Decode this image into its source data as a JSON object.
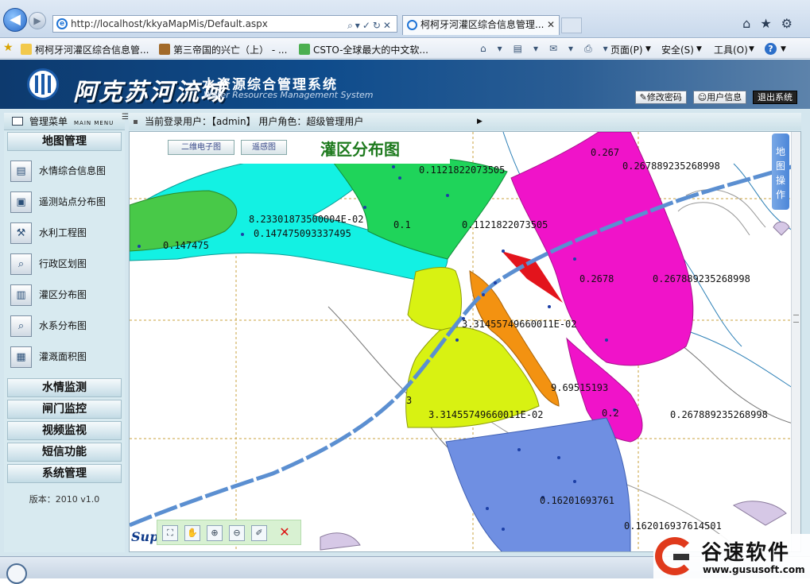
{
  "browser": {
    "url": "http://localhost/kkyaMapMis/Default.aspx",
    "tab_title": "柯柯牙河灌区综合信息管理...",
    "tab_close": "✕",
    "favorites": [
      {
        "label": "柯柯牙河灌区综合信息管...",
        "icon_color": "#f2c94c"
      },
      {
        "label": "第三帝国的兴亡（上） - ...",
        "icon_color": "#a26a2a"
      },
      {
        "label": "CSTO-全球最大的中文软...",
        "icon_color": "#4caf50"
      }
    ],
    "commands": {
      "page": "页面(P)",
      "safety": "安全(S)",
      "tools": "工具(O)",
      "help": "?"
    }
  },
  "header": {
    "title": "阿克苏河流域",
    "subtitle": "水资源综合管理系统",
    "subtitle_en": "Water Resources Management System",
    "buttons": {
      "change_password": "修改密码",
      "user_info": "用户信息",
      "logout": "退出系统"
    }
  },
  "sidebar": {
    "menu_title": "管理菜单",
    "menu_title_en": "MAIN MENU",
    "map_section": "地图管理",
    "map_items": [
      {
        "label": "水情综合信息图",
        "icon": "chart-icon"
      },
      {
        "label": "遥测站点分布图",
        "icon": "monitor-icon"
      },
      {
        "label": "水利工程图",
        "icon": "engineering-icon"
      },
      {
        "label": "行政区划图",
        "icon": "magnifier-icon"
      },
      {
        "label": "灌区分布图",
        "icon": "document-icon"
      },
      {
        "label": "水系分布图",
        "icon": "magnifier-icon"
      },
      {
        "label": "灌溉面积图",
        "icon": "screen-icon"
      }
    ],
    "sections": [
      "水情监测",
      "闸门监控",
      "视频监视",
      "短信功能",
      "系统管理"
    ],
    "version": "版本：2010 v1.0"
  },
  "status_bar": {
    "login_text": "当前登录用户：【admin】 用户角色：超级管理用户"
  },
  "map": {
    "tabs": [
      "二维电子图",
      "遥感图"
    ],
    "title": "灌区分布图",
    "side_button": "地图操作",
    "brand_text": "Sup",
    "labels": {
      "l1": "0.147475",
      "l2": "8.23301873500004E-02",
      "l3": "0.147475093337495",
      "l4": "0.1",
      "l5": "0.1121822073505",
      "l6": "0.1121822073505",
      "l7": "0.267",
      "l8": "0.267889235268998",
      "l9": "0.2678",
      "l10": "0.267889235268998",
      "l11": "3.31455749660011E-02",
      "l12": "9.69515193",
      "l13": "3",
      "l14": "3.31455749660011E-02",
      "l15": "0.2",
      "l16": "0.267889235268998",
      "l17": "0.16201693761",
      "l18": "0.162016937614501"
    },
    "zone_colors": {
      "cyan": "#13f1e3",
      "green": "#1fd45a",
      "lightgreen": "#48c948",
      "magenta": "#f013c9",
      "yellow": "#d8f212",
      "orange": "#f39211",
      "blue": "#6f8fe2",
      "red": "#e3141c"
    }
  },
  "watermark": {
    "name": "谷速软件",
    "url": "www.gususoft.com"
  }
}
